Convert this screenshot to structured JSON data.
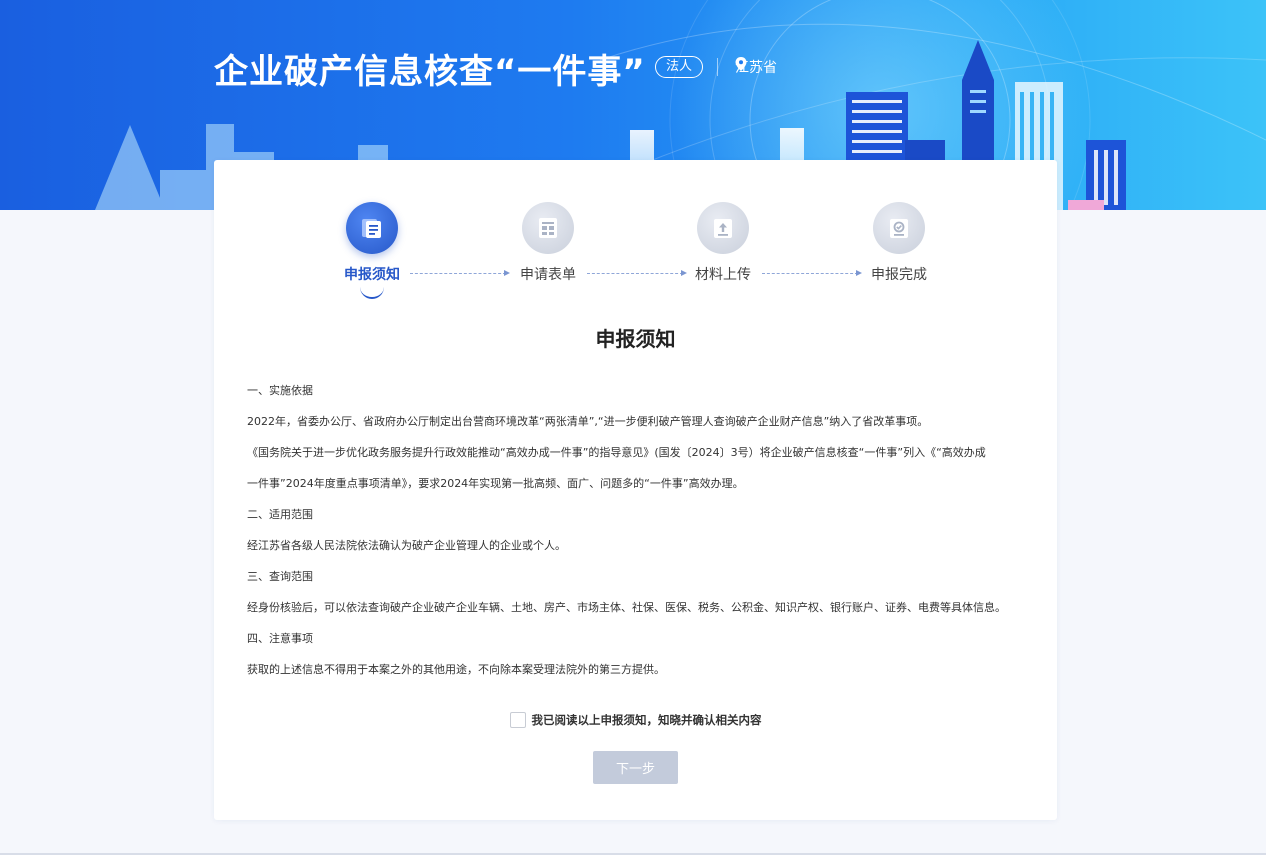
{
  "header": {
    "title": "企业破产信息核查“一件事”",
    "role_badge": "法人",
    "location": "江苏省",
    "location_icon": "map-pin-icon",
    "colors": {
      "banner_start": "#1a5fe0",
      "banner_end": "#3cc3f8"
    }
  },
  "steps": [
    {
      "label": "申报须知",
      "state": "active",
      "icon": "notice-icon"
    },
    {
      "label": "申请表单",
      "state": "inactive",
      "icon": "form-icon"
    },
    {
      "label": "材料上传",
      "state": "inactive",
      "icon": "upload-icon"
    },
    {
      "label": "申报完成",
      "state": "inactive",
      "icon": "complete-icon"
    }
  ],
  "notice": {
    "title": "申报须知",
    "paragraphs": [
      "一、实施依据",
      "2022年，省委办公厅、省政府办公厅制定出台营商环境改革“两张清单”,“进一步便利破产管理人查询破产企业财产信息”纳入了省改革事项。",
      "《国务院关于进一步优化政务服务提升行政效能推动“高效办成一件事”的指导意见》(国发〔2024〕3号）将企业破产信息核查“一件事”列入《“高效办成",
      "一件事”2024年度重点事项清单》，要求2024年实现第一批高频、面广、问题多的“一件事”高效办理。",
      "二、适用范围",
      "经江苏省各级人民法院依法确认为破产企业管理人的企业或个人。",
      "三、查询范围",
      "经身份核验后，可以依法查询破产企业破产企业车辆、土地、房产、市场主体、社保、医保、税务、公积金、知识产权、银行账户、证券、电费等具体信息。",
      "四、注意事项",
      "获取的上述信息不得用于本案之外的其他用途，不向除本案受理法院外的第三方提供。"
    ]
  },
  "confirm": {
    "label": "我已阅读以上申报须知，知晓并确认相关内容",
    "checked": false
  },
  "actions": {
    "next_label": "下一步",
    "next_enabled": false
  }
}
